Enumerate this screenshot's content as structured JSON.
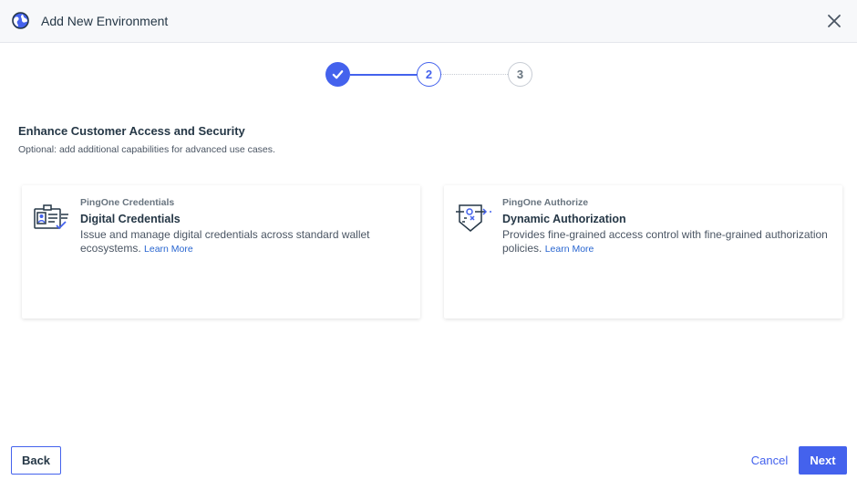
{
  "header": {
    "title": "Add New Environment",
    "icon": "globe-icon",
    "close_icon": "close-icon"
  },
  "stepper": {
    "steps": [
      {
        "label": "",
        "state": "complete",
        "icon": "check-icon"
      },
      {
        "label": "2",
        "state": "active"
      },
      {
        "label": "3",
        "state": "pending"
      }
    ]
  },
  "section": {
    "title": "Enhance Customer Access and Security",
    "subtitle": "Optional: add additional capabilities for advanced use cases."
  },
  "cards": [
    {
      "eyebrow": "PingOne Credentials",
      "name": "Digital Credentials",
      "description": "Issue and manage digital credentials across standard wallet ecosystems.",
      "link": "Learn More",
      "icon": "digital-credential-icon"
    },
    {
      "eyebrow": "PingOne Authorize",
      "name": "Dynamic Authorization",
      "description": "Provides fine-grained access control with fine-grained authorization policies.",
      "link": "Learn More",
      "icon": "authorization-policy-icon"
    }
  ],
  "footer": {
    "back_label": "Back",
    "cancel_label": "Cancel",
    "next_label": "Next"
  },
  "colors": {
    "accent": "#4462ed",
    "link": "#2966d0",
    "text": "#253746",
    "header_bg": "#f7f8fa"
  }
}
